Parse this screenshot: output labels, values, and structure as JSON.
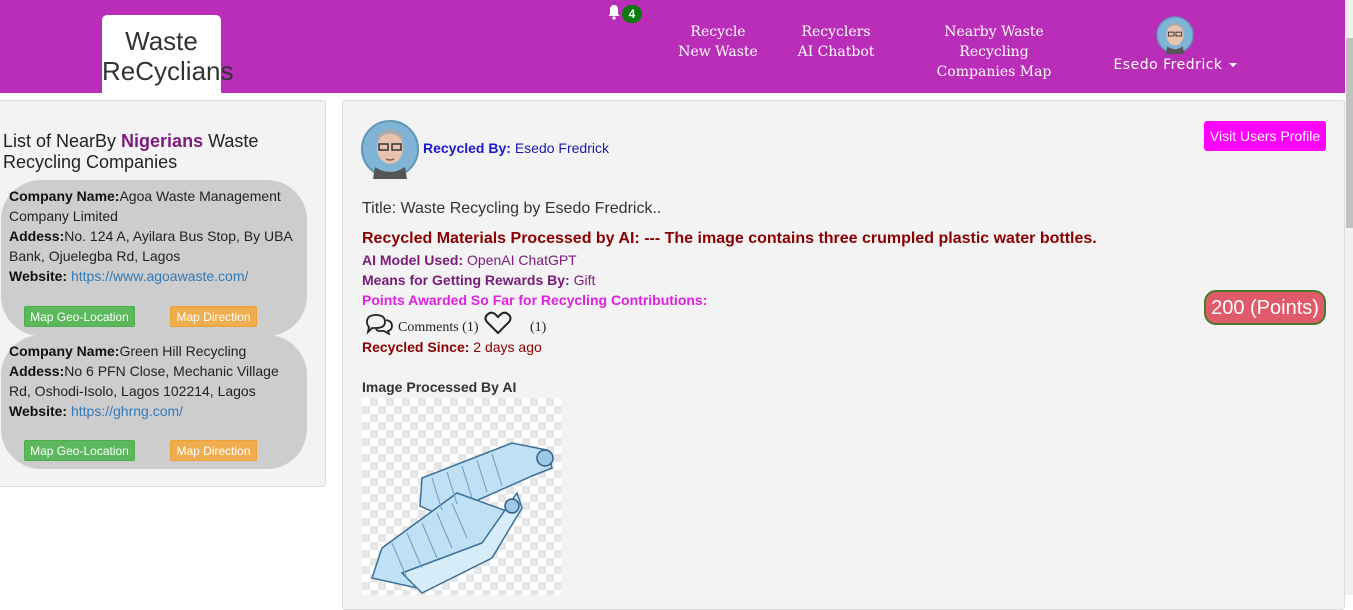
{
  "header": {
    "logo_line1": "Waste",
    "logo_line2": "ReCyclians",
    "notification_count": "4",
    "nav": [
      {
        "line1": "Recycle",
        "line2": "New Waste"
      },
      {
        "line1": "Recyclers",
        "line2": "AI Chatbot"
      },
      {
        "line1": "Nearby Waste Recycling",
        "line2": "Companies Map"
      }
    ],
    "user_name": "Esedo Fredrick"
  },
  "sidebar": {
    "title_prefix": "List of NearBy ",
    "title_highlight": "Nigerians",
    "title_suffix": " Waste Recycling Companies",
    "name_label": "Company Name:",
    "address_label": "Addess:",
    "website_label": "Website:",
    "geo_button": "Map Geo-Location",
    "direction_button": "Map Direction",
    "companies": [
      {
        "name": "Agoa Waste Management Company Limited",
        "address": "No. 124 A, Ayilara Bus Stop, By UBA Bank, Ojuelegba Rd, Lagos",
        "website": "https://www.agoawaste.com/"
      },
      {
        "name": "Green Hill Recycling",
        "address": "No 6 PFN Close, Mechanic Village Rd, Oshodi-Isolo, Lagos 102214, Lagos",
        "website": "https://ghrng.com/"
      }
    ]
  },
  "post": {
    "recycled_by_label": "Recycled By:",
    "recycled_by_name": "Esedo Fredrick",
    "visit_profile_button": "Visit Users Profile",
    "title": "Title: Waste Recycling by Esedo Fredrick..",
    "processed_text": "Recycled Materials Processed by AI: --- The image contains three crumpled plastic water bottles.",
    "ai_model_label": "AI Model Used:",
    "ai_model_value": "OpenAI ChatGPT",
    "means_label": "Means for Getting Rewards By:",
    "means_value": "Gift",
    "points_label": "Points Awarded So Far for Recycling Contributions:",
    "points_value": "200 (Points)",
    "comments_text": "Comments (1)",
    "likes_count": "(1)",
    "since_label": "Recycled Since:",
    "since_value": "2 days ago",
    "image_label": "Image Processed By AI"
  },
  "colors": {
    "nav_bg": "#b92db9",
    "visit_button": "#ff00ff",
    "points_badge": "#e05b6a",
    "geo_button": "#5cb85c",
    "direction_button": "#f0ad4e"
  }
}
